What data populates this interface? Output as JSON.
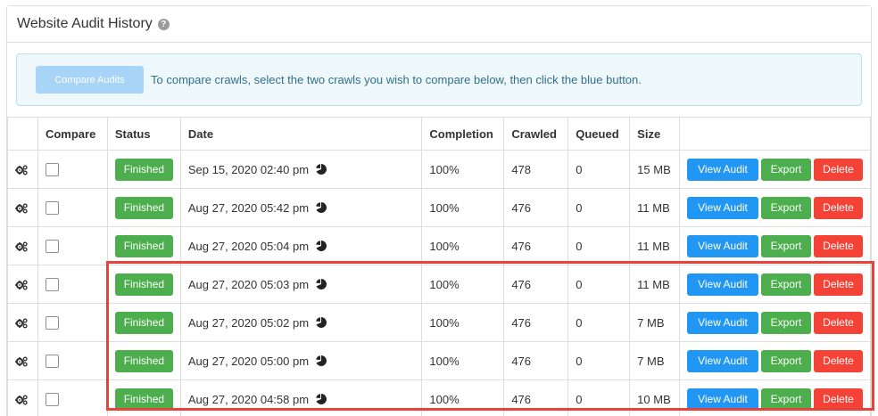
{
  "panel": {
    "title": "Website Audit History",
    "help_icon": "question-circle-icon"
  },
  "info": {
    "compare_button_label": "Compare Audits",
    "text": "To compare crawls, select the two crawls you wish to compare below, then click the blue button."
  },
  "table": {
    "headers": {
      "compare": "Compare",
      "status": "Status",
      "date": "Date",
      "completion": "Completion",
      "crawled": "Crawled",
      "queued": "Queued",
      "size": "Size"
    },
    "actions": {
      "view": "View Audit",
      "export": "Export",
      "delete": "Delete"
    },
    "rows": [
      {
        "status": "Finished",
        "date": "Sep 15, 2020 02:40 pm",
        "completion": "100%",
        "crawled": "478",
        "queued": "0",
        "size": "15 MB"
      },
      {
        "status": "Finished",
        "date": "Aug 27, 2020 05:42 pm",
        "completion": "100%",
        "crawled": "476",
        "queued": "0",
        "size": "11 MB"
      },
      {
        "status": "Finished",
        "date": "Aug 27, 2020 05:04 pm",
        "completion": "100%",
        "crawled": "476",
        "queued": "0",
        "size": "11 MB"
      },
      {
        "status": "Finished",
        "date": "Aug 27, 2020 05:03 pm",
        "completion": "100%",
        "crawled": "476",
        "queued": "0",
        "size": "11 MB"
      },
      {
        "status": "Finished",
        "date": "Aug 27, 2020 05:02 pm",
        "completion": "100%",
        "crawled": "476",
        "queued": "0",
        "size": "7 MB"
      },
      {
        "status": "Finished",
        "date": "Aug 27, 2020 05:00 pm",
        "completion": "100%",
        "crawled": "476",
        "queued": "0",
        "size": "7 MB"
      },
      {
        "status": "Finished",
        "date": "Aug 27, 2020 04:58 pm",
        "completion": "100%",
        "crawled": "476",
        "queued": "0",
        "size": "10 MB"
      }
    ]
  },
  "colors": {
    "primary": "#2196f3",
    "success": "#4cae4c",
    "danger": "#f44336",
    "highlight": "#e8433a",
    "info_bg": "#eef7f9"
  }
}
